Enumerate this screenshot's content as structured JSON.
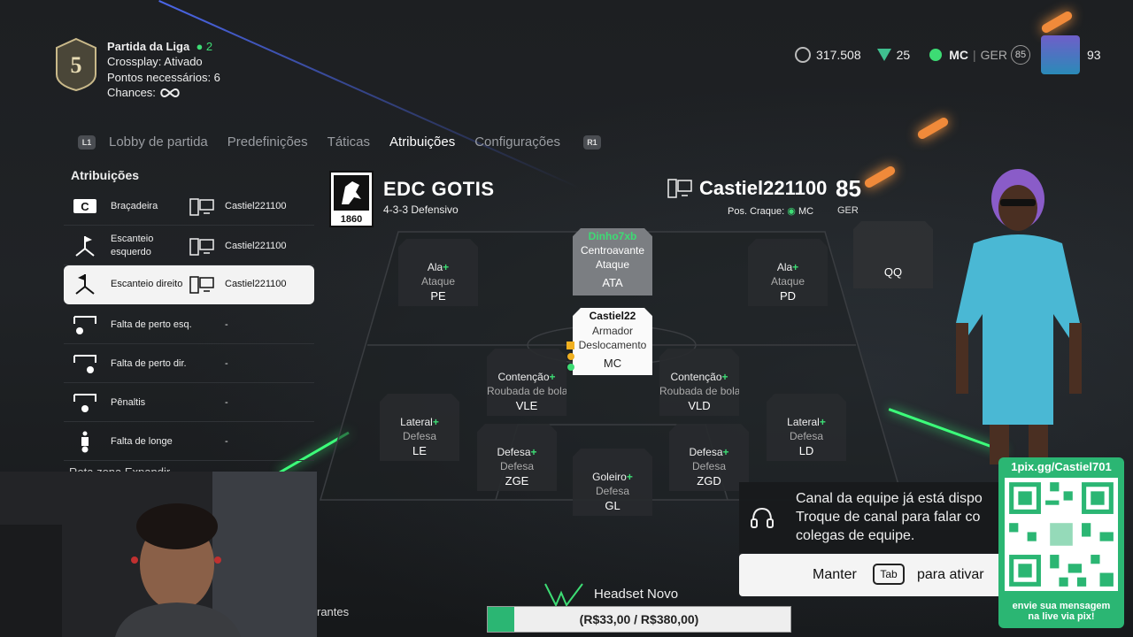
{
  "league": {
    "level": "5",
    "title": "Partida da Liga",
    "party_count": "2",
    "crossplay": "Crossplay: Ativado",
    "points": "Pontos necessários: 6",
    "chances_label": "Chances:"
  },
  "currency": {
    "coins": "317.508",
    "points": "25",
    "position": "MC",
    "ger_label": "GER",
    "ger_value": "85",
    "ovr": "93"
  },
  "tabs": {
    "left_button": "L1",
    "right_button": "R1",
    "items": [
      "Lobby de partida",
      "Predefinições",
      "Táticas",
      "Atribuições",
      "Configurações"
    ],
    "active": "Atribuições"
  },
  "panel": {
    "title": "Atribuições",
    "rows": [
      {
        "label": "Braçadeira",
        "value": "Castiel221100",
        "icon": "captain-armband-icon"
      },
      {
        "label": "Escanteio esquerdo",
        "value": "Castiel221100",
        "icon": "corner-left-icon"
      },
      {
        "label": "Escanteio direito",
        "value": "Castiel221100",
        "icon": "corner-right-icon"
      },
      {
        "label": "Falta de perto esq.",
        "value": "-",
        "icon": "free-kick-left-icon"
      },
      {
        "label": "Falta de perto dir.",
        "value": "-",
        "icon": "free-kick-right-icon"
      },
      {
        "label": "Pênaltis",
        "value": "-",
        "icon": "penalty-icon"
      },
      {
        "label": "Falta de longe",
        "value": "-",
        "icon": "long-free-kick-icon"
      }
    ],
    "partial_buttons": "Rota zona    Expandir"
  },
  "club": {
    "crest_year": "1860",
    "name": "EDC GOTIS",
    "formation": "4-3-3 Defensivo"
  },
  "player": {
    "name": "Castiel221100",
    "ovr": "85",
    "pos_label": "Pos. Craque:",
    "pos": "MC",
    "ger": "GER"
  },
  "pitch": {
    "cards": [
      {
        "id": "ata",
        "owner": "Dinho7xb",
        "role": "Centroavante",
        "focus": "Ataque",
        "pos": "ATA",
        "style": "gray"
      },
      {
        "id": "pe",
        "role": "Ala",
        "focus": "Ataque",
        "pos": "PE",
        "style": "dark"
      },
      {
        "id": "pd",
        "role": "Ala",
        "focus": "Ataque",
        "pos": "PD",
        "style": "dark"
      },
      {
        "id": "mc",
        "owner": "Castiel22",
        "role": "Armador",
        "focus": "Deslocamento",
        "pos": "MC",
        "style": "white"
      },
      {
        "id": "vle",
        "role": "Contenção",
        "focus": "Roubada de bola",
        "pos": "VLE",
        "style": "dark"
      },
      {
        "id": "vld",
        "role": "Contenção",
        "focus": "Roubada de bola",
        "pos": "VLD",
        "style": "dark"
      },
      {
        "id": "le",
        "role": "Lateral",
        "focus": "Defesa",
        "pos": "LE",
        "style": "dark"
      },
      {
        "id": "ld",
        "role": "Lateral",
        "focus": "Defesa",
        "pos": "LD",
        "style": "dark"
      },
      {
        "id": "zge",
        "role": "Defesa",
        "focus": "Defesa",
        "pos": "ZGE",
        "style": "dark"
      },
      {
        "id": "zgd",
        "role": "Defesa",
        "focus": "Defesa",
        "pos": "ZGD",
        "style": "dark"
      },
      {
        "id": "gl",
        "role": "Goleiro",
        "focus": "Defesa",
        "pos": "GL",
        "style": "dark"
      },
      {
        "id": "qq",
        "pos": "QQ",
        "style": "empty"
      }
    ]
  },
  "notification": {
    "line1": "Canal da equipe já está dispo",
    "line2": "Troque de canal para falar co",
    "line3": "colegas de equipe.",
    "hold_label": "Manter",
    "key": "Tab",
    "action": "para ativar"
  },
  "qr": {
    "url": "1pix.gg/Castiel701",
    "message_line1": "envie sua mensagem",
    "message_line2": "na live via pix!"
  },
  "stream": {
    "goal_title": "Headset Novo",
    "goal_progress": "(R$33,00 / R$380,00)",
    "goal_fraction": 0.087,
    "cut_text": "rantes"
  },
  "colors": {
    "accent_green": "#3ddc74",
    "qr_green": "#2bb673"
  }
}
